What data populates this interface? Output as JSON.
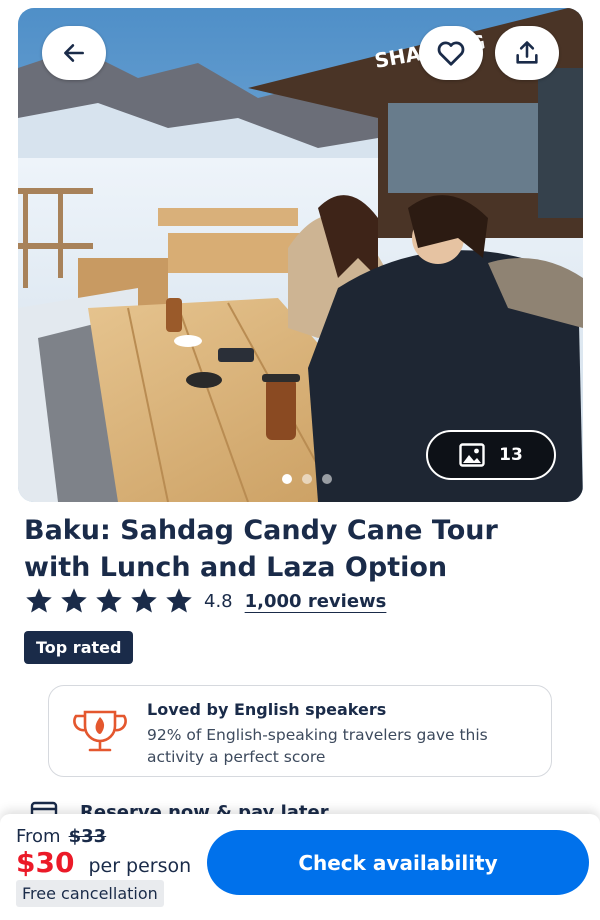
{
  "hero": {
    "photo_count": "13",
    "slides": 3,
    "active_slide": 1,
    "sign_text": "SHAHDAG"
  },
  "activity": {
    "title": "Baku: Sahdag Candy Cane Tour with Lunch and Laza Option",
    "rating": "4.8",
    "stars": 5,
    "reviews": "1,000 reviews",
    "badge": "Top rated"
  },
  "loved": {
    "title": "Loved by English speakers",
    "description": "92% of English-speaking travelers gave this activity a perfect score"
  },
  "reserve": {
    "label": "Reserve now & pay later"
  },
  "booking": {
    "from_label": "From",
    "old_price": "$33",
    "price": "$30",
    "per_label": "per person",
    "free_cancellation": "Free cancellation",
    "cta": "Check availability"
  },
  "colors": {
    "navy": "#1a2b49",
    "accent_blue": "#0071eb",
    "price_red": "#eb1a28",
    "icon_orange": "#e4572e"
  },
  "icons": {
    "back": "arrow-left-icon",
    "favorite": "heart-icon",
    "share": "share-icon",
    "gallery": "image-icon",
    "star": "star-icon",
    "loved": "trophy-icon",
    "reserve": "calendar-icon"
  }
}
